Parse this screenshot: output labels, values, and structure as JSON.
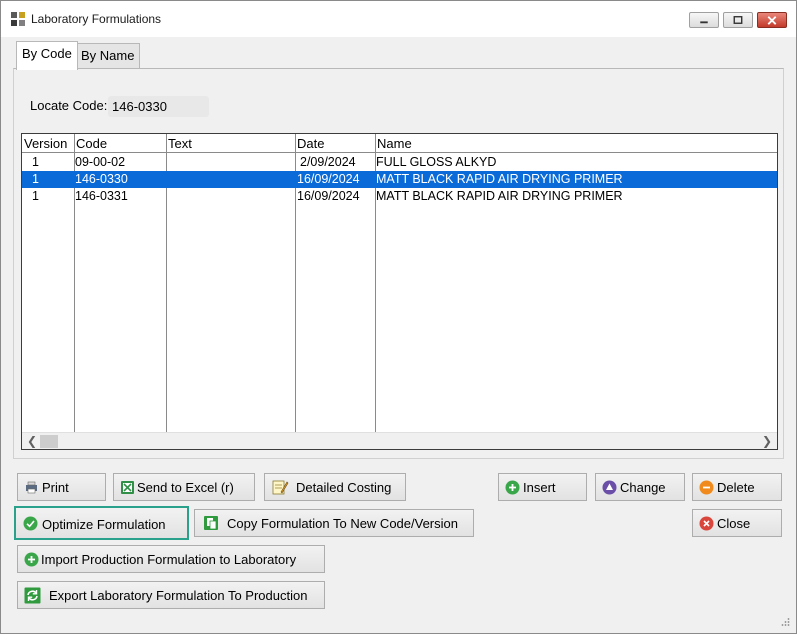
{
  "window": {
    "title": "Laboratory Formulations"
  },
  "tabs": [
    {
      "label": "By Code",
      "active": true
    },
    {
      "label": "By Name",
      "active": false
    }
  ],
  "locate": {
    "label": "Locate Code:",
    "value": "146-0330"
  },
  "grid": {
    "columns": [
      "Version",
      "Code",
      "Text",
      "Date",
      "Name"
    ],
    "rows": [
      {
        "version": "1",
        "code": "09-00-02",
        "text": "",
        "date": "2/09/2024",
        "name": "FULL GLOSS ALKYD",
        "selected": false
      },
      {
        "version": "1",
        "code": "146-0330",
        "text": "",
        "date": "16/09/2024",
        "name": "MATT BLACK RAPID AIR DRYING PRIMER",
        "selected": true
      },
      {
        "version": "1",
        "code": "146-0331",
        "text": "",
        "date": "16/09/2024",
        "name": "MATT BLACK RAPID AIR DRYING PRIMER",
        "selected": false
      }
    ]
  },
  "buttons": {
    "print": "Print",
    "send_excel": "Send to Excel (r)",
    "detailed_costing": "Detailed Costing",
    "insert": "Insert",
    "change": "Change",
    "delete": "Delete",
    "optimize": "Optimize Formulation",
    "copy": "Copy Formulation To New Code/Version",
    "close": "Close",
    "import": "Import Production  Formulation to Laboratory",
    "export": "Export Laboratory Formulation To Production"
  },
  "icons": {
    "print": "printer-icon",
    "excel": "excel-icon",
    "costing": "notepad-pencil-icon",
    "insert": "plus-circle-icon",
    "change": "up-triangle-circle-icon",
    "delete": "minus-circle-icon",
    "optimize": "check-circle-icon",
    "copy": "copy-icon",
    "close": "x-circle-icon",
    "import": "plus-circle-icon",
    "export": "refresh-arrows-icon"
  },
  "colors": {
    "selection": "#0a6ad8",
    "highlight_border": "#2aa18a",
    "green_icon": "#3aa64a",
    "purple_icon": "#6a4ea8",
    "orange_icon": "#f08a1c",
    "red_icon": "#d9473c"
  }
}
